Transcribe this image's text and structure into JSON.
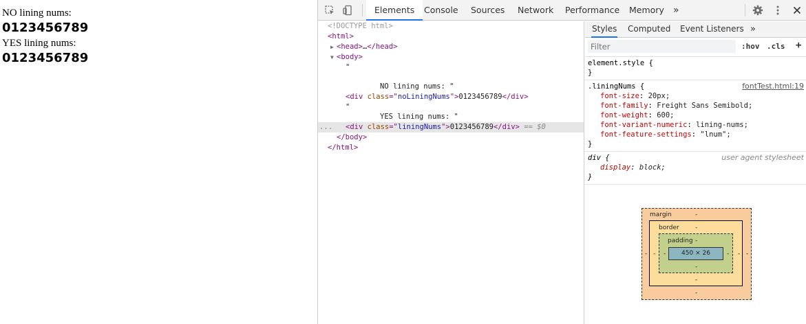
{
  "page": {
    "lines": [
      {
        "text": "NO lining nums:",
        "kind": "label"
      },
      {
        "text": "0123456789",
        "kind": "number"
      },
      {
        "text": "YES lining nums:",
        "kind": "label"
      },
      {
        "text": "0123456789",
        "kind": "number"
      }
    ]
  },
  "devtools": {
    "tabs": [
      "Elements",
      "Console",
      "Sources",
      "Network",
      "Performance",
      "Memory"
    ],
    "active_tab": "Elements",
    "more_tabs": "»",
    "icons": [
      "inspect-icon",
      "device-toggle-icon",
      "gear-icon",
      "kebab-menu-icon",
      "close-icon"
    ]
  },
  "dom": {
    "doctype": "<!DOCTYPE html>",
    "html_open": "<html>",
    "head_open": "<head>",
    "head_ellipsis": "…",
    "head_close": "</head>",
    "body_open": "<body>",
    "quote_open": "\"",
    "text_no": "NO lining nums: \"",
    "div_open": "<div",
    "attr_class": "class",
    "eq_quote": "=\"",
    "class_no": "noLiningNums",
    "close_quote_gt": "\">",
    "digits": "0123456789",
    "div_close": "</div>",
    "quote2": "\"",
    "text_yes": "YES lining nums: \"",
    "class_yes": "liningNums",
    "selected_marker": "== $0",
    "ellipsis_dots": "...",
    "body_close": "</body>",
    "html_close": "</html>"
  },
  "styles": {
    "subtabs": [
      "Styles",
      "Computed",
      "Event Listeners"
    ],
    "active_subtab": "Styles",
    "more": "»",
    "filter_placeholder": "Filter",
    "hov": ":hov",
    "cls": ".cls",
    "plus": "+",
    "element_style": {
      "selector": "element.style {",
      "close": "}"
    },
    "lining_rule": {
      "selector": ".liningNums {",
      "source": "fontTest.html:19",
      "declarations": [
        {
          "prop": "font-size",
          "value": "20px;"
        },
        {
          "prop": "font-family",
          "value": "Freight Sans Semibold;"
        },
        {
          "prop": "font-weight",
          "value": "600;"
        },
        {
          "prop": "font-variant-numeric",
          "value": "lining-nums;"
        },
        {
          "prop": "font-feature-settings",
          "value": "\"lnum\";"
        }
      ],
      "close": "}"
    },
    "ua_rule": {
      "selector": "div {",
      "source": "user agent stylesheet",
      "declarations": [
        {
          "prop": "display",
          "value": "block;"
        }
      ],
      "close": "}"
    }
  },
  "box_model": {
    "margin_label": "margin",
    "border_label": "border",
    "padding_label": "padding",
    "dash": "-",
    "content_size": "450 × 26"
  }
}
